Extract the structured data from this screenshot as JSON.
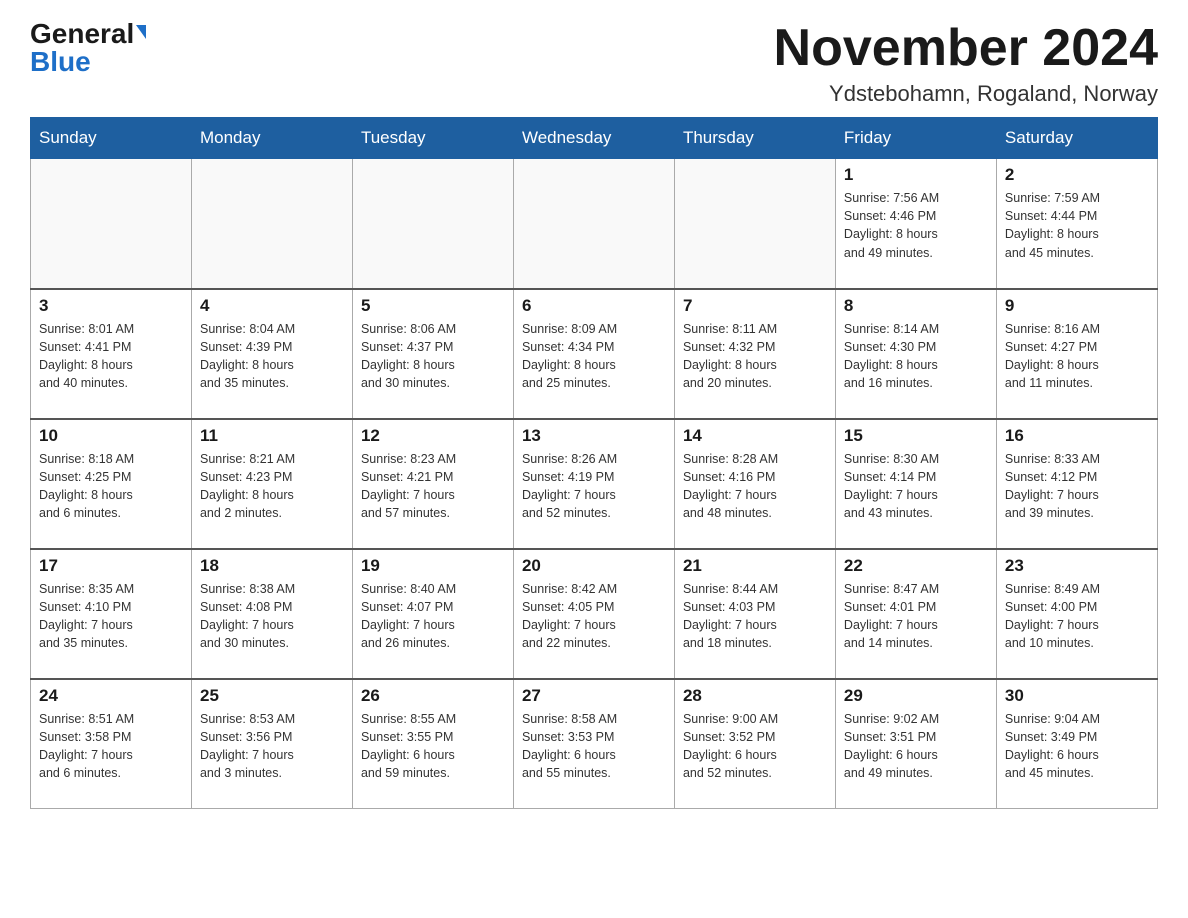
{
  "header": {
    "logo_general": "General",
    "logo_blue": "Blue",
    "month_title": "November 2024",
    "location": "Ydstebohamn, Rogaland, Norway"
  },
  "days_of_week": [
    "Sunday",
    "Monday",
    "Tuesday",
    "Wednesday",
    "Thursday",
    "Friday",
    "Saturday"
  ],
  "weeks": [
    [
      {
        "day": "",
        "info": ""
      },
      {
        "day": "",
        "info": ""
      },
      {
        "day": "",
        "info": ""
      },
      {
        "day": "",
        "info": ""
      },
      {
        "day": "",
        "info": ""
      },
      {
        "day": "1",
        "info": "Sunrise: 7:56 AM\nSunset: 4:46 PM\nDaylight: 8 hours\nand 49 minutes."
      },
      {
        "day": "2",
        "info": "Sunrise: 7:59 AM\nSunset: 4:44 PM\nDaylight: 8 hours\nand 45 minutes."
      }
    ],
    [
      {
        "day": "3",
        "info": "Sunrise: 8:01 AM\nSunset: 4:41 PM\nDaylight: 8 hours\nand 40 minutes."
      },
      {
        "day": "4",
        "info": "Sunrise: 8:04 AM\nSunset: 4:39 PM\nDaylight: 8 hours\nand 35 minutes."
      },
      {
        "day": "5",
        "info": "Sunrise: 8:06 AM\nSunset: 4:37 PM\nDaylight: 8 hours\nand 30 minutes."
      },
      {
        "day": "6",
        "info": "Sunrise: 8:09 AM\nSunset: 4:34 PM\nDaylight: 8 hours\nand 25 minutes."
      },
      {
        "day": "7",
        "info": "Sunrise: 8:11 AM\nSunset: 4:32 PM\nDaylight: 8 hours\nand 20 minutes."
      },
      {
        "day": "8",
        "info": "Sunrise: 8:14 AM\nSunset: 4:30 PM\nDaylight: 8 hours\nand 16 minutes."
      },
      {
        "day": "9",
        "info": "Sunrise: 8:16 AM\nSunset: 4:27 PM\nDaylight: 8 hours\nand 11 minutes."
      }
    ],
    [
      {
        "day": "10",
        "info": "Sunrise: 8:18 AM\nSunset: 4:25 PM\nDaylight: 8 hours\nand 6 minutes."
      },
      {
        "day": "11",
        "info": "Sunrise: 8:21 AM\nSunset: 4:23 PM\nDaylight: 8 hours\nand 2 minutes."
      },
      {
        "day": "12",
        "info": "Sunrise: 8:23 AM\nSunset: 4:21 PM\nDaylight: 7 hours\nand 57 minutes."
      },
      {
        "day": "13",
        "info": "Sunrise: 8:26 AM\nSunset: 4:19 PM\nDaylight: 7 hours\nand 52 minutes."
      },
      {
        "day": "14",
        "info": "Sunrise: 8:28 AM\nSunset: 4:16 PM\nDaylight: 7 hours\nand 48 minutes."
      },
      {
        "day": "15",
        "info": "Sunrise: 8:30 AM\nSunset: 4:14 PM\nDaylight: 7 hours\nand 43 minutes."
      },
      {
        "day": "16",
        "info": "Sunrise: 8:33 AM\nSunset: 4:12 PM\nDaylight: 7 hours\nand 39 minutes."
      }
    ],
    [
      {
        "day": "17",
        "info": "Sunrise: 8:35 AM\nSunset: 4:10 PM\nDaylight: 7 hours\nand 35 minutes."
      },
      {
        "day": "18",
        "info": "Sunrise: 8:38 AM\nSunset: 4:08 PM\nDaylight: 7 hours\nand 30 minutes."
      },
      {
        "day": "19",
        "info": "Sunrise: 8:40 AM\nSunset: 4:07 PM\nDaylight: 7 hours\nand 26 minutes."
      },
      {
        "day": "20",
        "info": "Sunrise: 8:42 AM\nSunset: 4:05 PM\nDaylight: 7 hours\nand 22 minutes."
      },
      {
        "day": "21",
        "info": "Sunrise: 8:44 AM\nSunset: 4:03 PM\nDaylight: 7 hours\nand 18 minutes."
      },
      {
        "day": "22",
        "info": "Sunrise: 8:47 AM\nSunset: 4:01 PM\nDaylight: 7 hours\nand 14 minutes."
      },
      {
        "day": "23",
        "info": "Sunrise: 8:49 AM\nSunset: 4:00 PM\nDaylight: 7 hours\nand 10 minutes."
      }
    ],
    [
      {
        "day": "24",
        "info": "Sunrise: 8:51 AM\nSunset: 3:58 PM\nDaylight: 7 hours\nand 6 minutes."
      },
      {
        "day": "25",
        "info": "Sunrise: 8:53 AM\nSunset: 3:56 PM\nDaylight: 7 hours\nand 3 minutes."
      },
      {
        "day": "26",
        "info": "Sunrise: 8:55 AM\nSunset: 3:55 PM\nDaylight: 6 hours\nand 59 minutes."
      },
      {
        "day": "27",
        "info": "Sunrise: 8:58 AM\nSunset: 3:53 PM\nDaylight: 6 hours\nand 55 minutes."
      },
      {
        "day": "28",
        "info": "Sunrise: 9:00 AM\nSunset: 3:52 PM\nDaylight: 6 hours\nand 52 minutes."
      },
      {
        "day": "29",
        "info": "Sunrise: 9:02 AM\nSunset: 3:51 PM\nDaylight: 6 hours\nand 49 minutes."
      },
      {
        "day": "30",
        "info": "Sunrise: 9:04 AM\nSunset: 3:49 PM\nDaylight: 6 hours\nand 45 minutes."
      }
    ]
  ]
}
